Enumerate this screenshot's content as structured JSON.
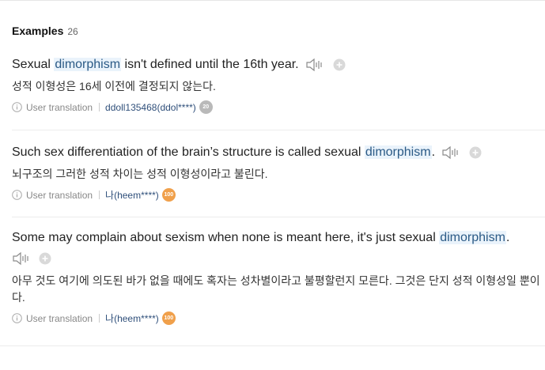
{
  "header": {
    "title": "Examples",
    "count": "26"
  },
  "colors": {
    "highlight_bg": "#eaf3fb",
    "badge_grey": "#b9b9b9",
    "badge_orange": "#f0a04b"
  },
  "examples": [
    {
      "pre": "Sexual ",
      "keyword": "dimorphism",
      "post": " isn't defined until the 16th year.",
      "translation": "성적 이형성은 16세 이전에 결정되지 않는다.",
      "source_label": "User translation",
      "user": "ddoll135468(ddol****)",
      "badge": "20"
    },
    {
      "pre": "Such sex differentiation of the brain’s structure is called sexual ",
      "keyword": "dimorphism",
      "post": ".",
      "translation": "뇌구조의 그러한 성적 차이는 성적 이형성이라고 불린다.",
      "source_label": "User translation",
      "user": "나(heem****)",
      "badge": "100"
    },
    {
      "pre": "Some may complain about sexism when none is meant here, it's just sexual ",
      "keyword": "dimorphism",
      "post": ".",
      "translation": "아무 것도 여기에 의도된 바가 없을 때에도 혹자는 성차별이라고 불평할런지 모른다. 그것은 단지 성적 이형성일 뿐이다.",
      "source_label": "User translation",
      "user": "나(heem****)",
      "badge": "100"
    }
  ]
}
